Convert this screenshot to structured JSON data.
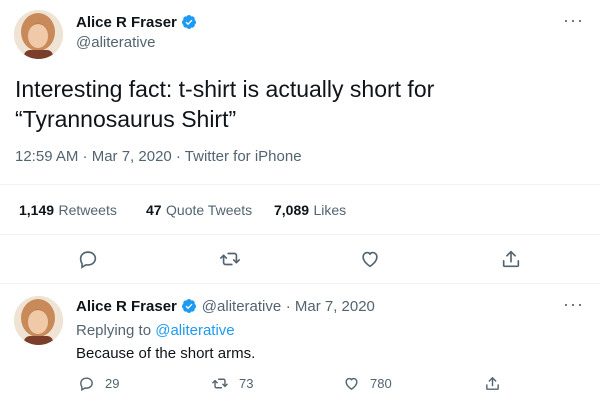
{
  "main_tweet": {
    "author_name": "Alice R Fraser",
    "author_handle": "@aliterative",
    "text_line1": "Interesting fact: t-shirt is actually short for",
    "text_line2": "“Tyrannosaurus Shirt”",
    "timestamp": "12:59 AM · Mar 7, 2020 · Twitter for iPhone",
    "retweets_count": "1,149",
    "retweets_label": "Retweets",
    "quotes_count": "47",
    "quotes_label": "Quote Tweets",
    "likes_count": "7,089",
    "likes_label": "Likes",
    "more_icon": "···"
  },
  "reply": {
    "author_name": "Alice R Fraser",
    "author_handle": "@aliterative",
    "date": "· Mar 7, 2020",
    "replying_prefix": "Replying to",
    "replying_handle": "@aliterative",
    "text": "Because of the short arms.",
    "reply_count": "29",
    "retweet_count": "73",
    "like_count": "780",
    "more_icon": "···"
  },
  "colors": {
    "accent": "#1d9bf0",
    "text": "#0f1419",
    "secondary": "#536471",
    "divider": "#eff3f4"
  }
}
